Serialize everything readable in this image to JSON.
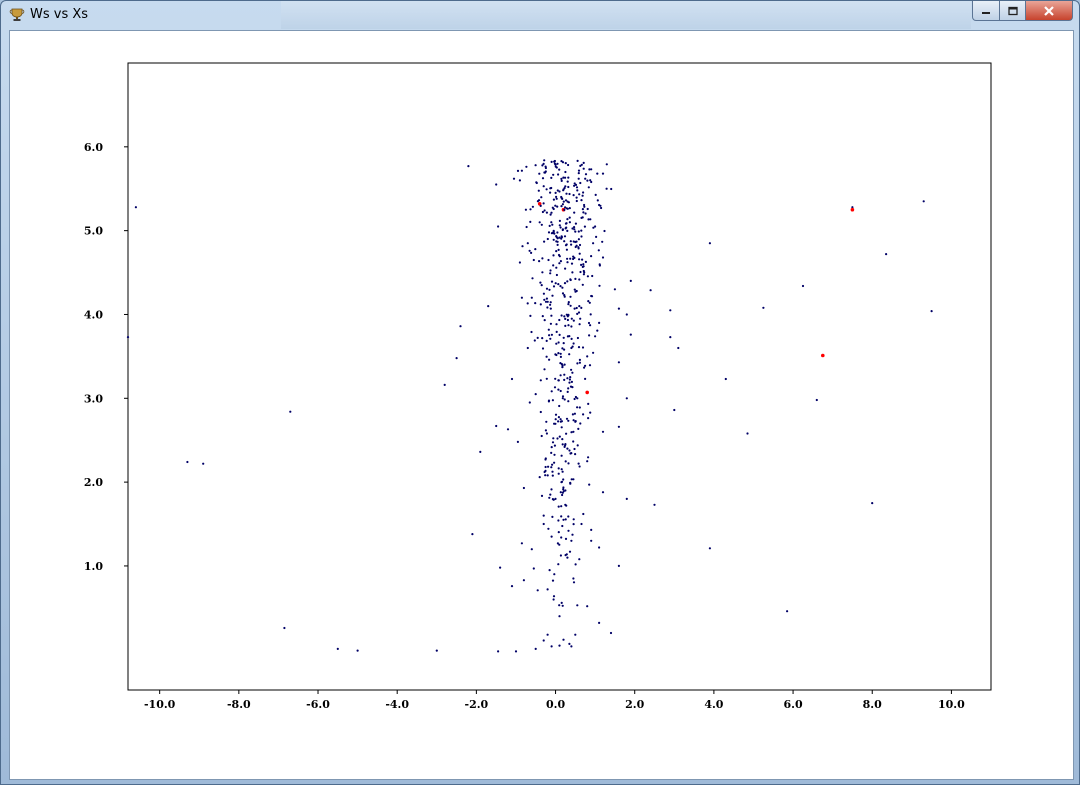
{
  "window": {
    "title": "Ws vs Xs",
    "icon": "trophy-app-icon",
    "controls": [
      "minimize-icon",
      "maximize-icon",
      "close-icon"
    ]
  },
  "chart_data": {
    "type": "scatter",
    "title": "",
    "xlabel": "",
    "ylabel": "",
    "xlim": [
      -10.8,
      11.0
    ],
    "ylim": [
      -0.48,
      7.0
    ],
    "x_ticks": [
      -10,
      -8,
      -6,
      -4,
      -2,
      0,
      2,
      4,
      6,
      8,
      10
    ],
    "x_tick_labels": [
      "-10.0",
      "-8.0",
      "-6.0",
      "-4.0",
      "-2.0",
      "0.0",
      "2.0",
      "4.0",
      "6.0",
      "8.0",
      "10.0"
    ],
    "y_ticks": [
      1,
      2,
      3,
      4,
      5,
      6
    ],
    "y_tick_labels": [
      "1.0",
      "2.0",
      "3.0",
      "4.0",
      "5.0",
      "6.0"
    ],
    "grid": false,
    "legend": "none",
    "colors": {
      "series_a": "#000066",
      "series_b": "#ff0000"
    },
    "series": [
      {
        "color": "#000066",
        "points": [
          [
            -10.6,
            5.28
          ],
          [
            -10.8,
            3.73
          ],
          [
            -9.3,
            2.24
          ],
          [
            -8.9,
            2.22
          ],
          [
            -6.7,
            2.84
          ],
          [
            -6.85,
            0.26
          ],
          [
            -5.5,
            0.01
          ],
          [
            -5.0,
            -0.01
          ],
          [
            -3.0,
            -0.01
          ],
          [
            -2.8,
            3.16
          ],
          [
            -2.4,
            3.86
          ],
          [
            -2.5,
            3.48
          ],
          [
            -2.2,
            5.77
          ],
          [
            -2.1,
            1.38
          ],
          [
            -1.9,
            2.36
          ],
          [
            -1.7,
            4.1
          ],
          [
            -1.5,
            5.55
          ],
          [
            -1.45,
            5.05
          ],
          [
            -1.5,
            2.67
          ],
          [
            -1.4,
            0.98
          ],
          [
            -1.45,
            -0.02
          ],
          [
            -1.2,
            2.63
          ],
          [
            -1.1,
            0.76
          ],
          [
            -1.0,
            -0.02
          ],
          [
            -1.1,
            3.23
          ],
          [
            -1.05,
            5.62
          ],
          [
            -0.9,
            5.6
          ],
          [
            -0.95,
            2.48
          ],
          [
            -0.9,
            4.62
          ],
          [
            -0.85,
            4.2
          ],
          [
            -0.8,
            1.93
          ],
          [
            -0.85,
            1.27
          ],
          [
            -0.8,
            0.83
          ],
          [
            -0.75,
            5.25
          ],
          [
            -0.7,
            4.85
          ],
          [
            -0.7,
            3.6
          ],
          [
            -0.65,
            2.95
          ],
          [
            -0.6,
            1.2
          ],
          [
            -0.55,
            0.97
          ],
          [
            -0.5,
            0.01
          ],
          [
            -0.45,
            0.71
          ],
          [
            -0.4,
            2.06
          ],
          [
            -0.3,
            0.11
          ],
          [
            -0.3,
            1.6
          ],
          [
            -0.2,
            0.18
          ],
          [
            -0.1,
            0.04
          ],
          [
            0.1,
            0.05
          ],
          [
            0.2,
            0.12
          ],
          [
            0.35,
            0.07
          ],
          [
            0.5,
            0.18
          ],
          [
            0.4,
            0.04
          ],
          [
            0.8,
            0.52
          ],
          [
            1.1,
            0.32
          ],
          [
            1.4,
            0.2
          ],
          [
            1.6,
            1.0
          ],
          [
            1.1,
            1.22
          ],
          [
            0.9,
            1.43
          ],
          [
            1.2,
            1.88
          ],
          [
            1.8,
            1.8
          ],
          [
            1.2,
            2.6
          ],
          [
            1.6,
            2.66
          ],
          [
            1.8,
            3.0
          ],
          [
            1.6,
            3.43
          ],
          [
            1.9,
            3.76
          ],
          [
            1.8,
            4.0
          ],
          [
            1.6,
            4.07
          ],
          [
            1.5,
            4.3
          ],
          [
            1.9,
            4.4
          ],
          [
            2.4,
            4.29
          ],
          [
            2.5,
            1.73
          ],
          [
            3.0,
            2.86
          ],
          [
            2.9,
            3.73
          ],
          [
            3.1,
            3.6
          ],
          [
            2.9,
            4.05
          ],
          [
            3.9,
            4.85
          ],
          [
            3.9,
            1.21
          ],
          [
            4.3,
            3.23
          ],
          [
            4.85,
            2.58
          ],
          [
            5.25,
            4.08
          ],
          [
            5.85,
            0.46
          ],
          [
            6.25,
            4.34
          ],
          [
            6.6,
            2.98
          ],
          [
            7.5,
            5.28
          ],
          [
            8.0,
            1.75
          ],
          [
            8.35,
            4.72
          ],
          [
            9.3,
            5.35
          ],
          [
            9.5,
            4.04
          ],
          [
            1.2,
            5.68
          ],
          [
            1.15,
            5.27
          ],
          [
            1.2,
            4.68
          ],
          [
            1.1,
            3.9
          ],
          [
            0.8,
            2.25
          ],
          [
            0.9,
            1.3
          ],
          [
            0.55,
            0.53
          ],
          [
            0.45,
            0.85
          ],
          [
            0.6,
            1.08
          ],
          [
            0.7,
            1.62
          ],
          [
            0.85,
            1.97
          ],
          [
            0.3,
            2.4
          ],
          [
            0.5,
            2.72
          ],
          [
            0.3,
            3.24
          ],
          [
            0.8,
            3.5
          ],
          [
            1.0,
            3.74
          ],
          [
            0.9,
            4.22
          ],
          [
            0.95,
            4.85
          ],
          [
            1.0,
            5.05
          ],
          [
            0.9,
            5.58
          ],
          [
            0.75,
            5.62
          ],
          [
            0.3,
            1.1
          ],
          [
            0.2,
            1.55
          ],
          [
            0.15,
            2.0
          ],
          [
            0.05,
            2.52
          ],
          [
            0.0,
            1.8
          ],
          [
            -0.1,
            1.35
          ],
          [
            -0.15,
            0.95
          ],
          [
            -0.05,
            0.6
          ],
          [
            0.1,
            0.4
          ],
          [
            -0.2,
            0.72
          ],
          [
            -0.3,
            1.5
          ],
          [
            -0.25,
            2.18
          ],
          [
            -0.35,
            2.55
          ],
          [
            -0.5,
            3.05
          ],
          [
            -0.45,
            3.72
          ],
          [
            -0.6,
            4.2
          ],
          [
            -0.55,
            4.65
          ],
          [
            -0.4,
            5.1
          ],
          [
            -0.3,
            5.53
          ],
          [
            -0.1,
            5.82
          ],
          [
            0.15,
            5.83
          ],
          [
            0.25,
            5.7
          ],
          [
            0.55,
            5.48
          ],
          [
            0.65,
            5.0
          ],
          [
            0.7,
            4.6
          ],
          [
            0.6,
            4.1
          ],
          [
            0.4,
            3.6
          ],
          [
            0.55,
            3.0
          ],
          [
            0.45,
            2.6
          ],
          [
            0.25,
            1.9
          ],
          [
            0.4,
            1.3
          ],
          [
            -0.35,
            4.35
          ]
        ]
      },
      {
        "color": "#ff0000",
        "points": [
          [
            7.5,
            5.25
          ],
          [
            6.75,
            3.51
          ],
          [
            0.8,
            3.07
          ],
          [
            -0.4,
            5.32
          ],
          [
            0.2,
            5.25
          ]
        ]
      }
    ]
  }
}
